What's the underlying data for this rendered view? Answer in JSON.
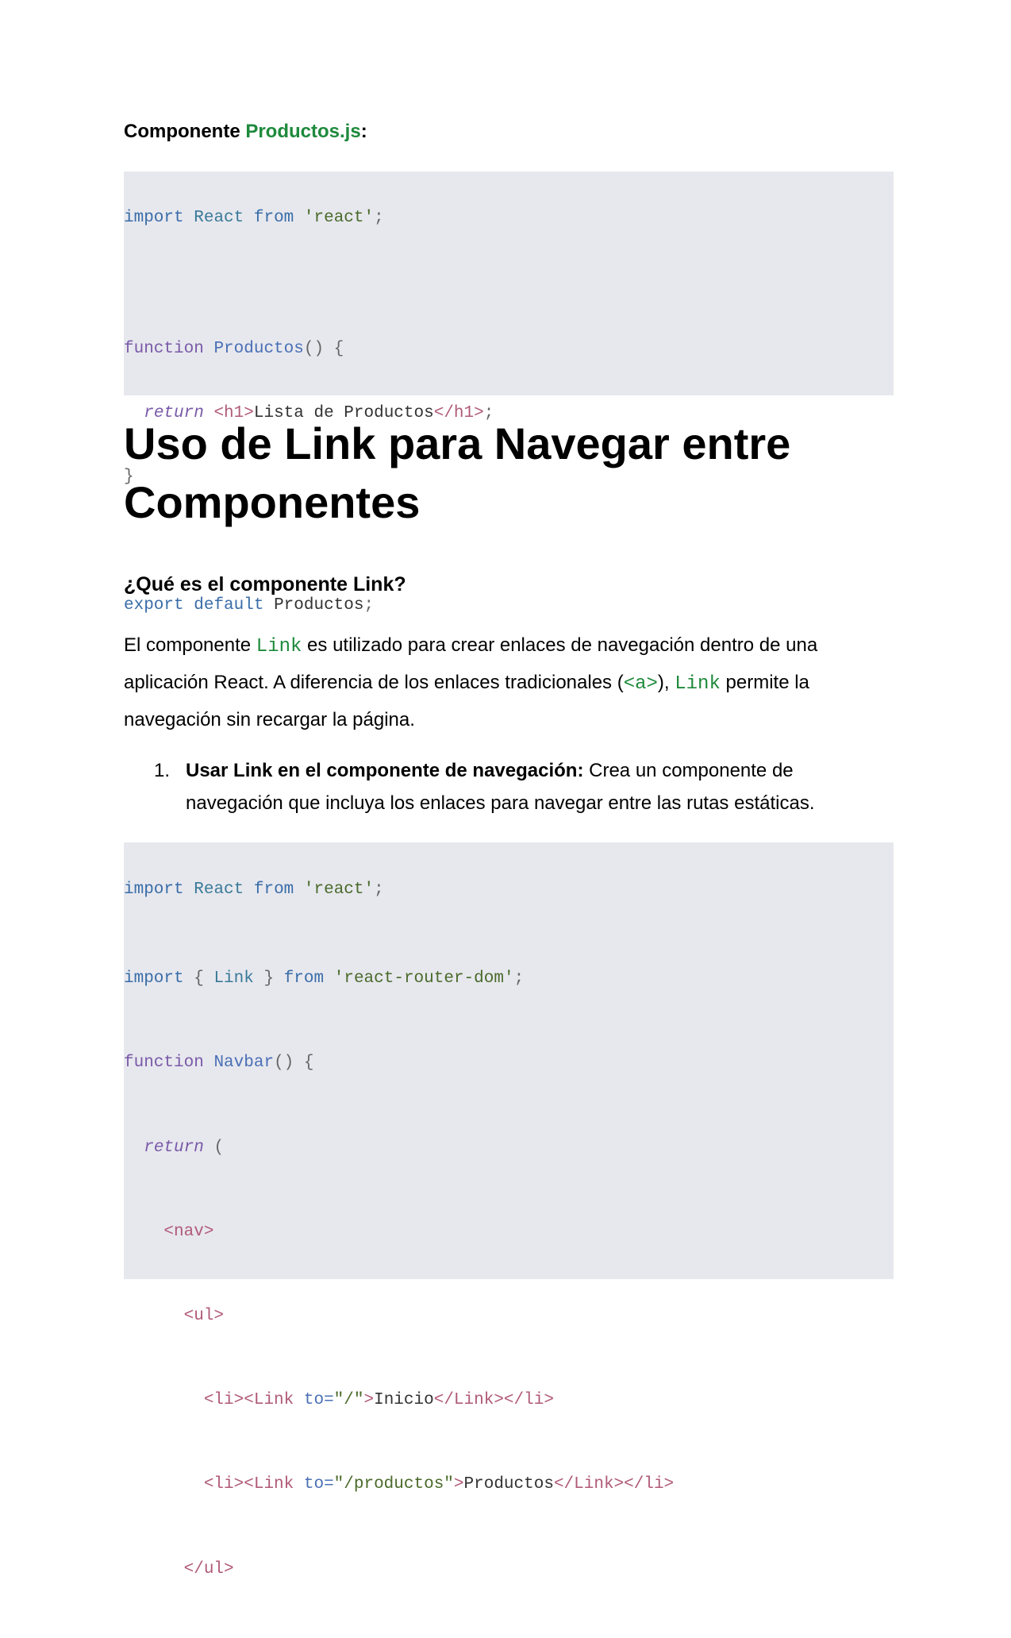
{
  "label": {
    "prefix": "Componente ",
    "file": "Productos.js",
    "suffix": ":"
  },
  "code1": {
    "l1": {
      "a": "import",
      "b": "React",
      "c": "from",
      "d": "'react'",
      "e": ";"
    },
    "l3": {
      "a": "function",
      "b": "Productos",
      "c": "() {"
    },
    "l4": {
      "a": "return",
      "b": "<h1>",
      "c": "Lista de Productos",
      "d": "</h1>",
      "e": ";"
    },
    "l5": {
      "a": "}"
    },
    "l7": {
      "a": "export",
      "b": "default",
      "c": "Productos",
      "d": ";"
    }
  },
  "heading1": "Uso de Link para Navegar entre Componentes",
  "heading3": "¿Qué es el componente Link?",
  "paragraph": {
    "p1": "El componente ",
    "c1": "Link",
    "p2": " es utilizado para crear enlaces de navegación dentro de una aplicación React. A diferencia de los enlaces tradicionales (",
    "c2": "<a>",
    "p3": "), ",
    "c3": "Link",
    "p4": " permite la navegación sin recargar la página."
  },
  "list": {
    "number": "1.",
    "bold": "Usar Link en el componente de navegación:",
    "text": " Crea un componente de navegación que incluya los enlaces para navegar entre las rutas estáticas."
  },
  "code2": {
    "l1": {
      "a": "import",
      "b": "React",
      "c": "from",
      "d": "'react'",
      "e": ";"
    },
    "l2": {
      "a": "import",
      "b": "{",
      "c": "Link",
      "d": "}",
      "e": "from",
      "f": "'react-router-dom'",
      "g": ";"
    },
    "l3": {
      "a": "function",
      "b": "Navbar",
      "c": "() {"
    },
    "l4": {
      "a": "return",
      "b": " ("
    },
    "l5": {
      "a": "<nav>"
    },
    "l6": {
      "a": "<ul>"
    },
    "l7": {
      "a": "<li><Link ",
      "b": "to=",
      "c": "\"/\"",
      "d": ">",
      "e": "Inicio",
      "f": "</Link></li>"
    },
    "l8": {
      "a": "<li><Link ",
      "b": "to=",
      "c": "\"/productos\"",
      "d": ">",
      "e": "Productos",
      "f": "</Link></li>"
    },
    "l9": {
      "a": "</ul>"
    }
  }
}
